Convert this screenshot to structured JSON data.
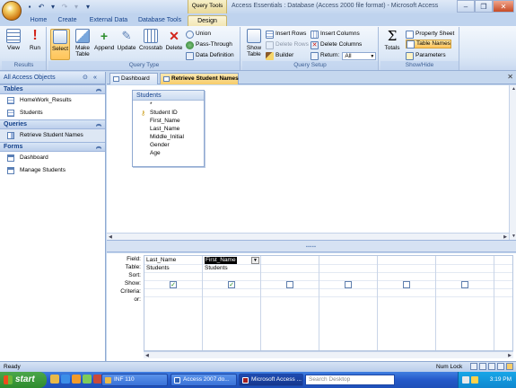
{
  "window": {
    "context_tab_header": "Query Tools",
    "title": "Access Essentials : Database (Access 2000 file format) - Microsoft Access"
  },
  "ribbon_tabs": [
    "Home",
    "Create",
    "External Data",
    "Database Tools",
    "Design"
  ],
  "ribbon": {
    "groups": {
      "results": "Results",
      "query_type": "Query Type",
      "query_setup": "Query Setup",
      "show_hide": "Show/Hide"
    },
    "buttons": {
      "view": "View",
      "run": "Run",
      "select": "Select",
      "make_table": "Make Table",
      "append": "Append",
      "update": "Update",
      "crosstab": "Crosstab",
      "delete": "Delete",
      "union": "Union",
      "pass_through": "Pass-Through",
      "data_definition": "Data Definition",
      "show_table": "Show Table",
      "insert_rows": "Insert Rows",
      "delete_rows": "Delete Rows",
      "builder": "Builder",
      "insert_columns": "Insert Columns",
      "delete_columns": "Delete Columns",
      "return_label": "Return:",
      "return_value": "All",
      "totals": "Totals",
      "property_sheet": "Property Sheet",
      "table_names": "Table Names",
      "parameters": "Parameters"
    }
  },
  "nav": {
    "header": "All Access Objects",
    "sections": [
      {
        "title": "Tables",
        "items": [
          "HomeWork_Results",
          "Students"
        ]
      },
      {
        "title": "Queries",
        "items": [
          "Retrieve Student Names"
        ]
      },
      {
        "title": "Forms",
        "items": [
          "Dashboard",
          "Manage Students"
        ]
      }
    ]
  },
  "doc_tabs": [
    "Dashboard",
    "Retrieve Student Names"
  ],
  "table_box": {
    "title": "Students",
    "fields": [
      "*",
      "Student ID",
      "First_Name",
      "Last_Name",
      "Middle_Initial",
      "Gender",
      "Age"
    ]
  },
  "grid": {
    "row_labels": [
      "Field:",
      "Table:",
      "Sort:",
      "Show:",
      "Criteria:",
      "or:"
    ],
    "columns": [
      {
        "field": "Last_Name",
        "table": "Students",
        "show": true
      },
      {
        "field": "First_Name",
        "table": "Students",
        "show": true
      },
      {
        "field": "",
        "table": "",
        "show": false
      },
      {
        "field": "",
        "table": "",
        "show": false
      },
      {
        "field": "",
        "table": "",
        "show": false
      },
      {
        "field": "",
        "table": "",
        "show": false
      }
    ]
  },
  "status": {
    "left": "Ready",
    "num_lock": "Num Lock"
  },
  "taskbar": {
    "start": "start",
    "tasks": [
      "INF 110",
      "Access 2007.do...",
      "Microsoft Access ..."
    ],
    "search_placeholder": "Search Desktop",
    "clock": "3:19 PM"
  },
  "colors": {
    "ribbon_selected": "#ffc45a",
    "active_doc_tab": "#f7cd6a",
    "taskbar": "#2459c9",
    "start_button": "#2e8b2e"
  }
}
